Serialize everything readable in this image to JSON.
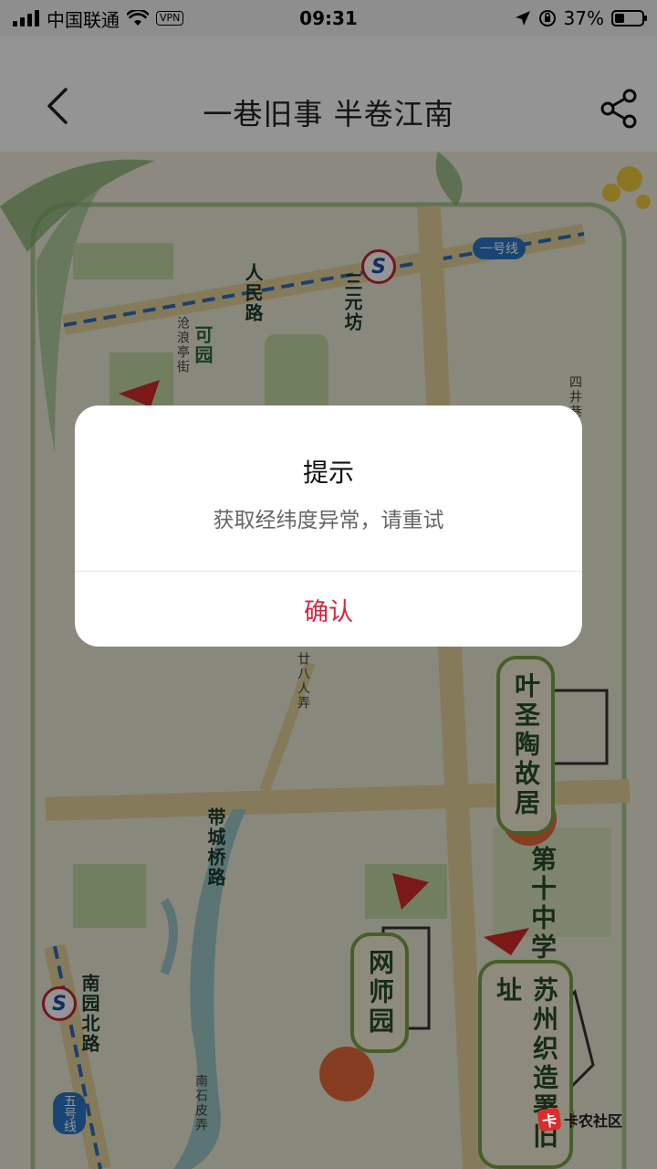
{
  "status_bar": {
    "carrier": "中国联通",
    "vpn": "VPN",
    "time": "09:31",
    "battery": "37%",
    "battery_level": 0.37
  },
  "nav": {
    "title": "一巷旧事 半卷江南",
    "back_icon": "chevron-left-icon",
    "share_icon": "share-icon"
  },
  "map": {
    "labels": {
      "metro_sanyuanfang": "三元坊",
      "metro_line_badge": "一号线",
      "renmin_road": "人民路",
      "canglang_street": "沧浪亭街",
      "keyuan": "可园",
      "daicheng_road": "带城桥路",
      "nanyuan_north_road": "南园北路",
      "metro_line5_badge": "五号线",
      "xiangjia": "廿八人弄",
      "nanshipihong": "南石皮弄",
      "sijingxiang": "四井巷"
    },
    "landmarks": {
      "ye_shengtao": "叶圣陶故居",
      "no10_middle_school": "第十中学",
      "wangshi_garden": "网师园",
      "suzhou_weaving": "苏州织造署旧址"
    }
  },
  "dialog": {
    "title": "提示",
    "message": "获取经纬度异常，请重试",
    "confirm": "确认"
  },
  "watermark": {
    "text": "卡农社区"
  },
  "colors": {
    "accent": "#d0283c",
    "plaque_border": "#7ba24b",
    "map_bg": "#f3efe1"
  }
}
